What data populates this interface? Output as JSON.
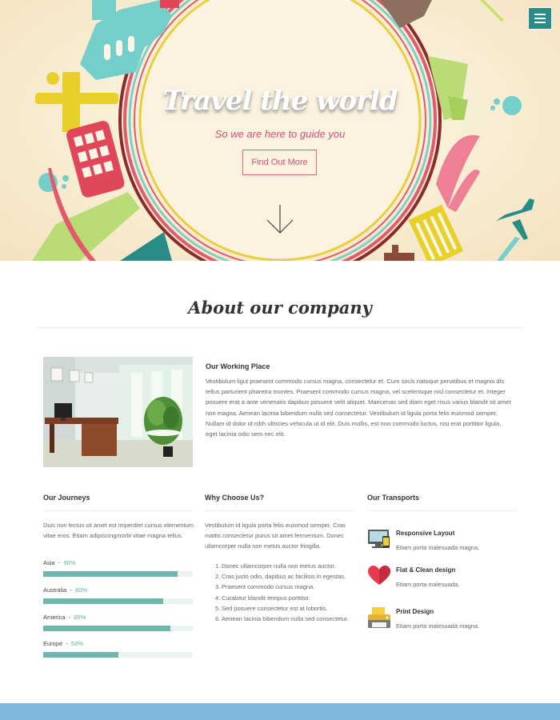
{
  "hero": {
    "title": "Travel the world",
    "subtitle": "So we are here to guide you",
    "cta_label": "Find Out More"
  },
  "about": {
    "title": "About our company",
    "working_place": {
      "title": "Our Working Place",
      "text": "Vestibulum ligut praesent commodo cursus magna, consectetur et. Cum socis natoque penatibus et magnis dis tellus parturient pharetra montes. Praesent commodo cursus magna, vel scelerisque nisl consectetur et. Integer posuere erat a ante venenatis dapibus posuere velit aliquet. Maecenas sed diam eget risus varius blandit sit amet non magna. Aenean lacinia bibendum nulla sed consectetur. Vestibulum id ligula porta felis euismod semper. Nullam id dolor id nibh ultricies vehicula ut id elit. Duis mollis, est non commodo luctus, nisi erat porttitor ligula, eget lacinia odio sem nec elit."
    }
  },
  "journeys": {
    "title": "Our Journeys",
    "text": "Duis non lectus sit amet est imperdiet cursus elementum vitae eros. Etiam adipiscingmorbi vitae magna tellus.",
    "items": [
      {
        "label": "Asia",
        "percent_label": "90%",
        "value": 90
      },
      {
        "label": "Australia",
        "percent_label": "80%",
        "value": 80
      },
      {
        "label": "America",
        "percent_label": "85%",
        "value": 85
      },
      {
        "label": "Europe",
        "percent_label": "50%",
        "value": 50
      }
    ]
  },
  "why": {
    "title": "Why Choose Us?",
    "text": "Vestibulum id ligula porta felis euismod semper. Cras mattis consectetur purus sit amet fermentum. Donec ullamcorper nulla non metus auctor fringilla.",
    "list": [
      "Donec ullamcorper nulla non metus auctor.",
      "Cras justo odio, dapibus ac facilisis in egestas.",
      "Praesent commodo cursus magna.",
      "Curabitur blandit tempus porttitor.",
      "Sed posuere consectetur est at lobortis.",
      "Aenean lacinia bibendum nulla sed consectetur."
    ]
  },
  "transports": {
    "title": "Our Transports",
    "items": [
      {
        "icon": "responsive-devices-icon",
        "title": "Responsive Layout",
        "text": "Etiam porta malesuada magna."
      },
      {
        "icon": "heart-icon",
        "title": "Flat & Clean design",
        "text": "Etiam porta malesuada."
      },
      {
        "icon": "printer-icon",
        "title": "Print Design",
        "text": "Etiam porta malesuada magna."
      }
    ]
  },
  "colors": {
    "teal": "#2a8c87",
    "pink": "#d0507a",
    "progress": "#6fb6ae",
    "footer": "#7eb6d9"
  }
}
